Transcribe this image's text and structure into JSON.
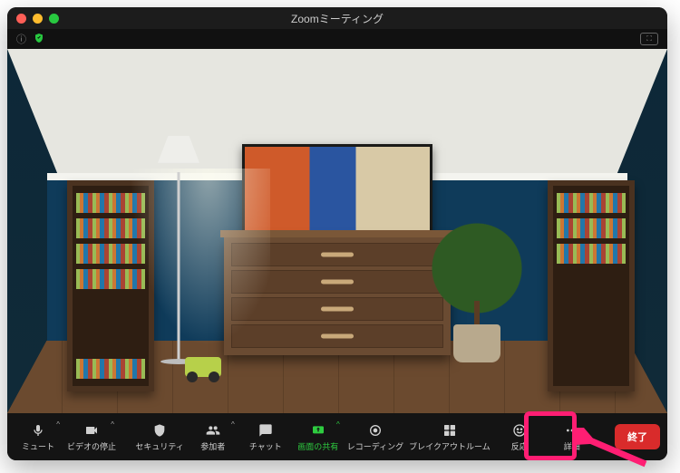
{
  "window": {
    "title": "Zoomミーティング"
  },
  "status": {
    "info_icon": "ⓘ",
    "enc_icon": "✔",
    "expand_icon": "⛶"
  },
  "controls": {
    "mute": {
      "label": "ミュート"
    },
    "video": {
      "label": "ビデオの停止"
    },
    "security": {
      "label": "セキュリティ"
    },
    "participants": {
      "label": "参加者"
    },
    "chat": {
      "label": "チャット"
    },
    "share": {
      "label": "画面の共有"
    },
    "record": {
      "label": "レコーディング"
    },
    "breakout": {
      "label": "ブレイクアウトルーム"
    },
    "reactions": {
      "label": "反応"
    },
    "more": {
      "label": "詳細"
    }
  },
  "end": {
    "label": "終了"
  },
  "annotation": {
    "target": "more-button",
    "color": "#ff1e73"
  }
}
